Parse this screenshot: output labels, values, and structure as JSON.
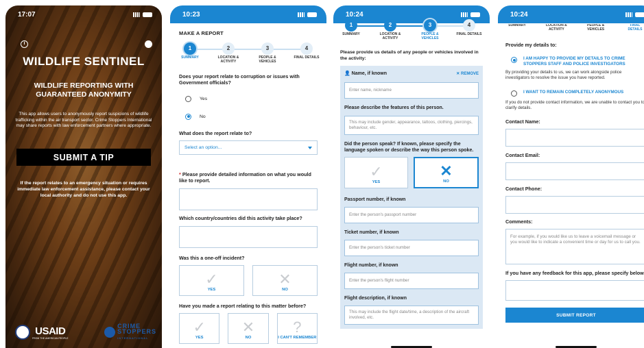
{
  "screen1": {
    "time": "17:07",
    "title": "WILDLIFE SENTINEL",
    "subtitle": "WILDLIFE REPORTING WITH GUARANTEED ANONYMITY",
    "description": "This app allows users to anonymously report suspicions of wildlife trafficking within the air transport sector. Crime Stoppers International may share reports with law enforcement partners where appropriate.",
    "submit_label": "SUBMIT A TIP",
    "emergency": "If the report relates to an emergency situation or requires immediate law enforcement assistance, please contact your local authority and do not use this app.",
    "usaid_logo": "USAID",
    "usaid_tagline": "FROM THE AMERICAN PEOPLE",
    "cs_logo_line1": "CRIME",
    "cs_logo_line2": "STOPPERS",
    "cs_logo_line3": "INTERNATIONAL"
  },
  "screen2": {
    "time": "10:23",
    "heading": "MAKE A REPORT",
    "steps": [
      {
        "num": "1",
        "label": "SUMMARY"
      },
      {
        "num": "2",
        "label": "LOCATION & ACTIVITY"
      },
      {
        "num": "3",
        "label": "PEOPLE & VEHICLES"
      },
      {
        "num": "4",
        "label": "FINAL DETAILS"
      }
    ],
    "q_corruption": "Does your report relate to corruption or issues with Government officials?",
    "opt_yes": "Yes",
    "opt_no": "No",
    "q_relate": "What does the report relate to?",
    "select_placeholder": "Select an option...",
    "required_mark": "*",
    "q_details": "Please provide detailed information on what you would like to report.",
    "q_country": "Which country/countries did this activity take place?",
    "q_oneoff": "Was this a one-off incident?",
    "tile_yes": "YES",
    "tile_no": "NO",
    "q_previous": "Have you made a report relating to this matter before?",
    "tile_cant": "I CAN'T REMEMBER"
  },
  "screen3": {
    "time": "10:24",
    "steps": [
      {
        "num": "1",
        "label": "SUMMARY"
      },
      {
        "num": "2",
        "label": "LOCATION & ACTIVITY"
      },
      {
        "num": "3",
        "label": "PEOPLE & VEHICLES"
      },
      {
        "num": "4",
        "label": "FINAL DETAILS"
      }
    ],
    "intro": "Please provide us details of any people or vehicles involved in the activity:",
    "name_label": "Name, if known",
    "remove_label": "REMOVE",
    "name_placeholder": "Enter name, nickname",
    "features_label": "Please describe the features of this person.",
    "features_placeholder": "This may include gender, appearance, tattoos, clothing, piercings, behaviour, etc.",
    "spoke_label": "Did the person speak? If known, please specify the language spoken or describe the way this person spoke.",
    "tile_yes": "YES",
    "tile_no": "NO",
    "passport_label": "Passport number, if known",
    "passport_placeholder": "Enter the person's passport number",
    "ticket_label": "Ticket number, if known",
    "ticket_placeholder": "Enter the person's ticket number",
    "flight_label": "Flight number, if known",
    "flight_placeholder": "Enter the person's flight number",
    "flightdesc_label": "Flight description, if known",
    "flightdesc_placeholder": "This may include the flight date/time, a description of the aircraft involved, etc."
  },
  "screen4": {
    "time": "10:24",
    "step_labels": [
      "SUMMARY",
      "LOCATION & ACTIVITY",
      "PEOPLE & VEHICLES",
      "FINAL DETAILS"
    ],
    "provide_label": "Provide my details to:",
    "opt_happy": "I AM HAPPY TO PROVIDE MY DETAILS TO CRIME STOPPERS STAFF AND POLICE INVESTIGATORS",
    "happy_copy": "By providing your details to us, we can work alongside police investigators to resolve the issue you have reported.",
    "opt_anon": "I WANT TO REMAIN COMPLETELY ANONYMOUS",
    "anon_copy": "If you do not provide contact information, we are unable to contact you to clarify details.",
    "contact_name": "Contact Name:",
    "contact_email": "Contact Email:",
    "contact_phone": "Contact Phone:",
    "comments": "Comments:",
    "comments_placeholder": "For example, if you would like us to leave a voicemail message or you would like to indicate a convenient time or day for us to call you.",
    "feedback": "If you have any feedback for this app, please specify below:",
    "submit": "SUBMIT REPORT"
  },
  "colors": {
    "accent": "#1b86d1",
    "required": "#d12b2b",
    "card_bg": "#dbe8f4"
  }
}
